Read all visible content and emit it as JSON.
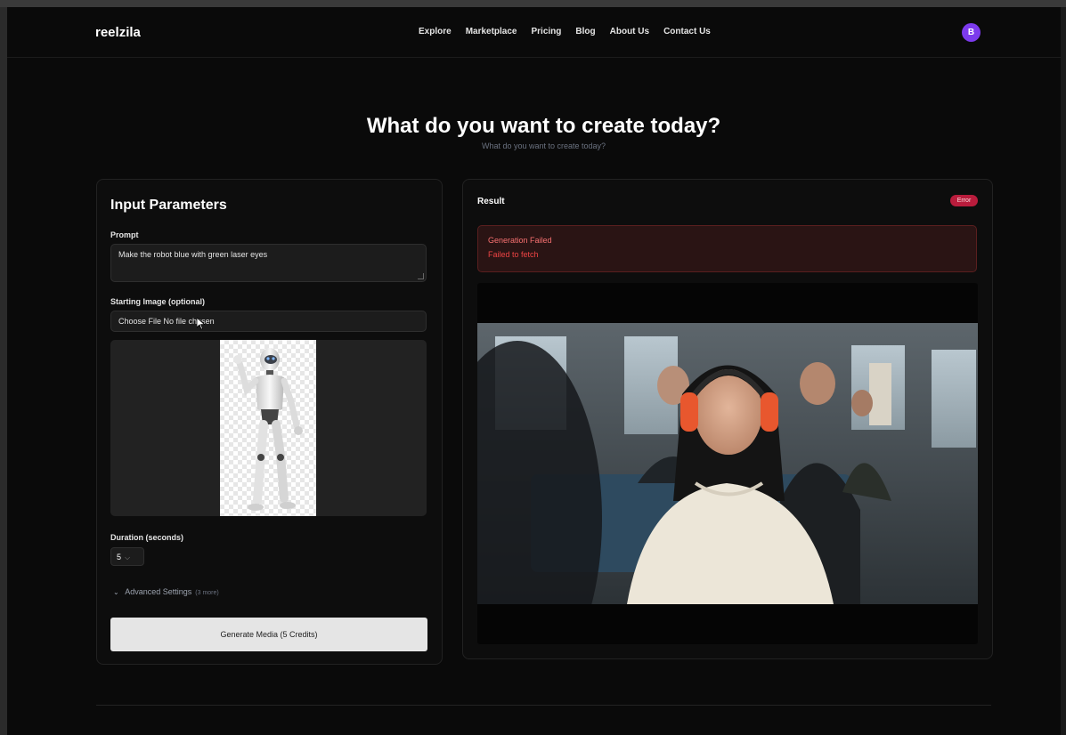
{
  "app": {
    "logo": "reelzila",
    "avatar_initial": "B",
    "accent_color": "#7c3aed"
  },
  "nav": {
    "items": [
      "Explore",
      "Marketplace",
      "Pricing",
      "Blog",
      "About Us",
      "Contact Us"
    ]
  },
  "hero": {
    "title": "What do you want to create today?",
    "subtitle": "What do you want to create today?"
  },
  "input_panel": {
    "title": "Input Parameters",
    "prompt_label": "Prompt",
    "prompt_value": "Make the robot blue with green laser eyes",
    "image_label": "Starting Image (optional)",
    "file_button": "Choose File",
    "file_status": "No file chosen",
    "duration_label": "Duration (seconds)",
    "duration_value": "5",
    "advanced_label": "Advanced Settings",
    "advanced_more": "(3 more)",
    "generate_button": "Generate Media (5 Credits)"
  },
  "result_panel": {
    "title": "Result",
    "status_badge": "Error",
    "error_title": "Generation Failed",
    "error_message": "Failed to fetch",
    "status_color": "#b91c3c"
  }
}
